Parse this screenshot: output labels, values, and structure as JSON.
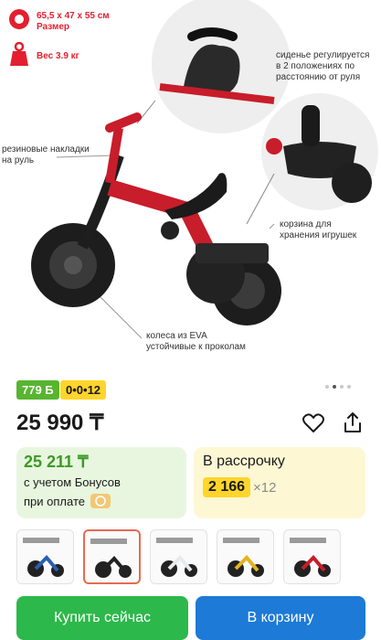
{
  "specs": {
    "size_value": "65,5 x 47 x 55 см",
    "size_label": "Размер",
    "weight": "Вес 3.9 кг"
  },
  "notes": {
    "seat": "сиденье регулируется\nв 2 положениях по\nрасстоянию от руля",
    "grips": "резиновые накладки\nна руль",
    "basket": "корзина для\nхранения игрушек",
    "wheels": "колеса из EVA\nустойчивые к проколам"
  },
  "badges": {
    "bonus": "779 Б",
    "installment": "0•0•12"
  },
  "price": "25 990 ₸",
  "bonus_card": {
    "price": "25 211 ₸",
    "line1": "с учетом Бонусов",
    "line2": "при оплате"
  },
  "installment_card": {
    "title": "В рассрочку",
    "amount": "2 166",
    "times": "×12"
  },
  "buttons": {
    "buy": "Купить сейчас",
    "cart": "В корзину"
  },
  "colors": {
    "accent_red": "#e3202f",
    "buy_green": "#2db84b",
    "cart_blue": "#1d7ad6"
  },
  "gallery": {
    "slides_total": 4,
    "active_slide": 2,
    "thumbnail_count": 5,
    "active_thumbnail": 2
  }
}
